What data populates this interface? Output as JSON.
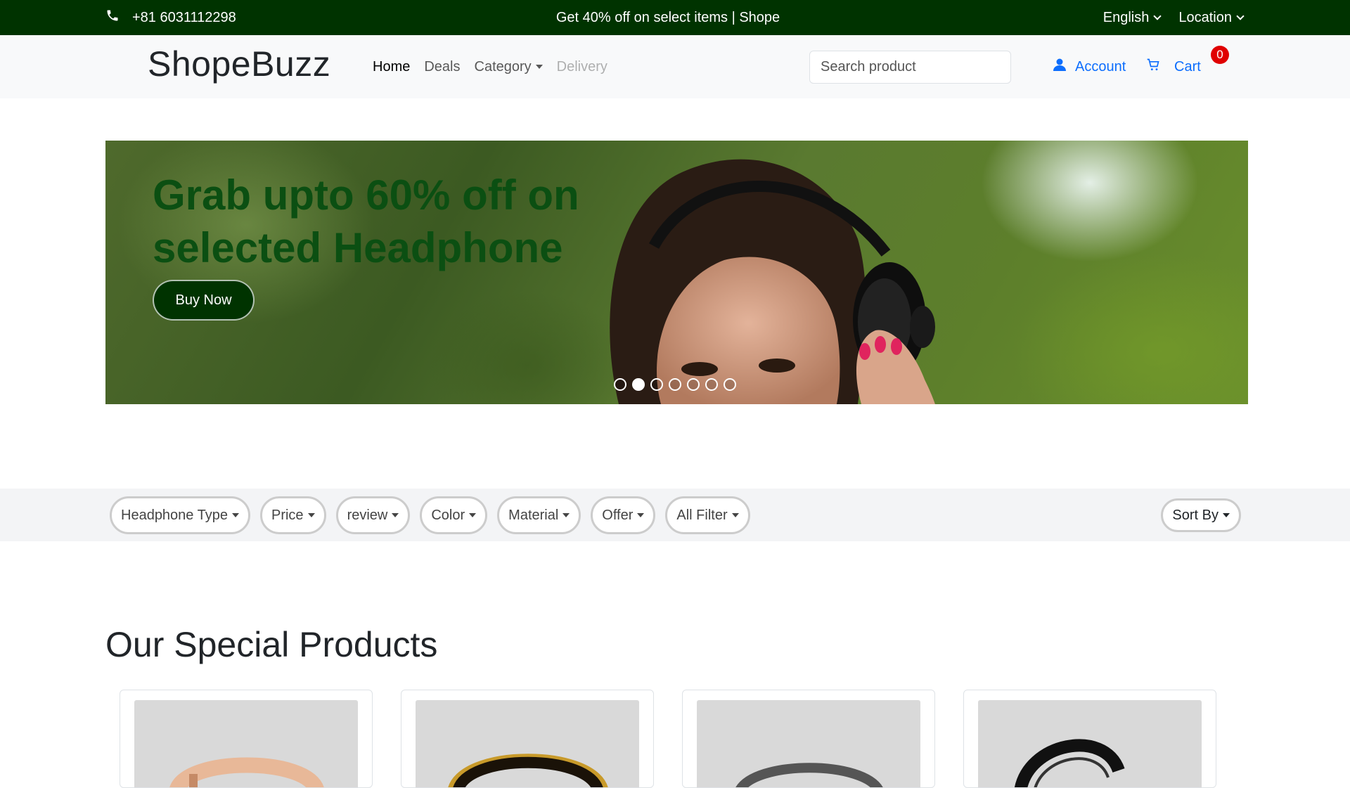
{
  "topbar": {
    "phone": "+81 6031112298",
    "promo": "Get 40% off on select items | Shope",
    "language": "English",
    "location": "Location"
  },
  "navbar": {
    "brand": "ShopeBuzz",
    "links": {
      "home": "Home",
      "deals": "Deals",
      "category": "Category",
      "delivery": "Delivery"
    },
    "search_placeholder": "Search product",
    "account": "Account",
    "cart": "Cart",
    "cart_count": "0"
  },
  "hero": {
    "title_line1": "Grab upto 60% off on",
    "title_line2": "selected Headphone",
    "button": "Buy Now",
    "slides": 7,
    "active_slide": 2
  },
  "filters": {
    "headphone_type": "Headphone Type",
    "price": "Price",
    "review": "review",
    "color": "Color",
    "material": "Material",
    "offer": "Offer",
    "all_filter": "All Filter",
    "sort_by": "Sort By"
  },
  "products": {
    "section_title": "Our Special Products",
    "items": [
      {
        "icon": "headphone-peach-icon",
        "color": "#e8b898"
      },
      {
        "icon": "headphone-gold-icon",
        "color": "#c89a2a"
      },
      {
        "icon": "headphone-grey-icon",
        "color": "#555555"
      },
      {
        "icon": "headphone-black-icon",
        "color": "#111111"
      }
    ]
  },
  "colors": {
    "topbar_bg": "#003300",
    "accent": "#0d6efd",
    "hero_title": "#0b4f12",
    "badge": "#e00000"
  }
}
